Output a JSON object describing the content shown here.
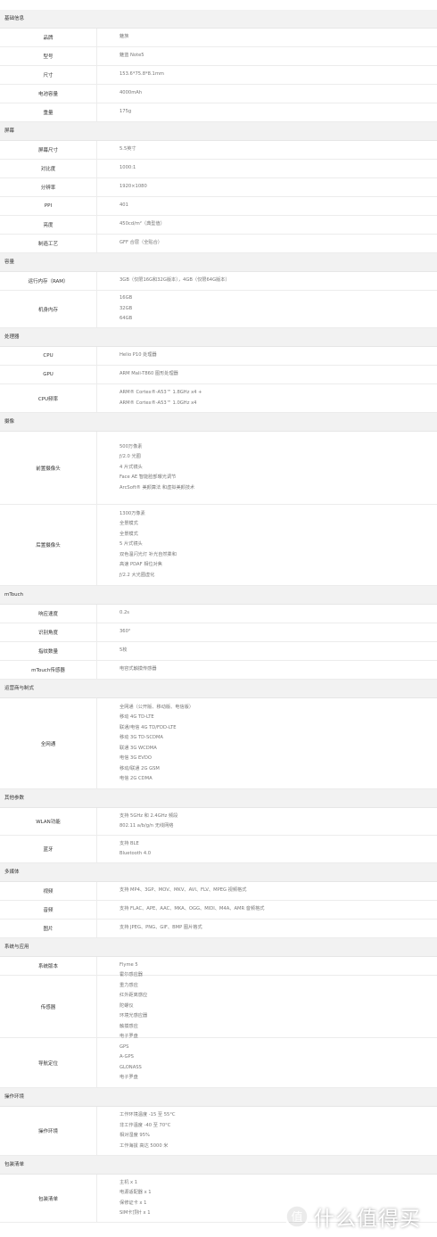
{
  "sections": [
    {
      "title": "基础信息",
      "rows": [
        {
          "label": "品牌",
          "values": [
            "魅族"
          ]
        },
        {
          "label": "型号",
          "values": [
            "魅蓝 Note5"
          ]
        },
        {
          "label": "尺寸",
          "values": [
            "153.6*75.8*8.1mm"
          ]
        },
        {
          "label": "电池容量",
          "values": [
            "4000mAh"
          ]
        },
        {
          "label": "重量",
          "values": [
            "175g"
          ]
        }
      ]
    },
    {
      "title": "屏幕",
      "rows": [
        {
          "label": "屏幕尺寸",
          "values": [
            "5.5英寸"
          ]
        },
        {
          "label": "对比度",
          "values": [
            "1000:1"
          ]
        },
        {
          "label": "分辨率",
          "values": [
            "1920×1080"
          ]
        },
        {
          "label": "PPI",
          "values": [
            "401"
          ]
        },
        {
          "label": "亮度",
          "values": [
            "450cd/m²（典型值）"
          ]
        },
        {
          "label": "制造工艺",
          "values": [
            "GFF 合层（全贴合）"
          ]
        }
      ]
    },
    {
      "title": "容量",
      "rows": [
        {
          "label": "运行内存（RAM）",
          "values": [
            "3GB（仅限16G和32G版本），4GB（仅限64G版本）"
          ]
        },
        {
          "label": "机身内存",
          "values": [
            "16GB",
            "32GB",
            "64GB"
          ]
        }
      ]
    },
    {
      "title": "处理器",
      "rows": [
        {
          "label": "CPU",
          "values": [
            "Helio P10 处理器"
          ]
        },
        {
          "label": "GPU",
          "values": [
            "ARM Mali-T860 图形处理器"
          ]
        },
        {
          "label": "CPU频率",
          "values": [
            "ARM® Cortex®-A53™ 1.8GHz x4 +",
            "ARM® Cortex®-A53™ 1.0GHz x4"
          ]
        }
      ]
    },
    {
      "title": "摄像",
      "rows": [
        {
          "label": "前置摄像头",
          "values": [
            "500万像素",
            "ƒ/2.0 光圈",
            "4 片式镜头",
            "Face AE 智能脸部曝光调节",
            "ArcSoft® 美颜算法 和虚拟美颜技术"
          ]
        },
        {
          "label": "后置摄像头",
          "values": [
            "1300万像素",
            "全景模式",
            "全景模式",
            "5 片式镜头",
            "双色温闪光灯 补光自然柔和",
            "高速 PDAF 相位对焦",
            "ƒ/2.2 大光圈虚化"
          ]
        }
      ]
    },
    {
      "title": "mTouch",
      "rows": [
        {
          "label": "响应速度",
          "values": [
            "0.2s"
          ]
        },
        {
          "label": "识别角度",
          "values": [
            "360°"
          ]
        },
        {
          "label": "指纹数量",
          "values": [
            "5枚"
          ]
        },
        {
          "label": "mTouch传感器",
          "values": [
            "电容式触摸传感器"
          ]
        }
      ]
    },
    {
      "title": "运营商与制式",
      "rows": [
        {
          "label": "全网通",
          "values": [
            "全网通（公开版、移动版、电信版）",
            "移动 4G TD-LTE",
            "联通/电信 4G TD/FDD-LTE",
            "移动 3G TD-SCDMA",
            "联通 3G WCDMA",
            "电信 3G EVDO",
            "移动/联通 2G GSM",
            "电信 2G CDMA"
          ]
        }
      ]
    },
    {
      "title": "其他参数",
      "rows": [
        {
          "label": "WLAN功能",
          "values": [
            "支持 5GHz 和 2.4GHz 频段",
            "802.11 a/b/g/n 无线网络"
          ]
        },
        {
          "label": "蓝牙",
          "values": [
            "支持 BLE",
            "Bluetooth 4.0"
          ]
        }
      ]
    },
    {
      "title": "多媒体",
      "rows": [
        {
          "label": "视频",
          "values": [
            "支持 MP4、3GP、MOV、MKV、AVI、FLV、MPEG 视频格式"
          ]
        },
        {
          "label": "音频",
          "values": [
            "支持 FLAC、APE、AAC、MKA、OGG、MIDI、M4A、AMR 音频格式"
          ]
        },
        {
          "label": "图片",
          "values": [
            "支持 JPEG、PNG、GIF、BMP 图片格式"
          ]
        }
      ]
    },
    {
      "title": "系统与应用",
      "rows": [
        {
          "label": "系统版本",
          "values": [
            "Flyme 5"
          ]
        },
        {
          "label": "传感器",
          "values": [
            "霍尔感应器",
            "重力感应",
            "红外距离感应",
            "陀螺仪",
            "环境光感应器",
            "触摸感应",
            "电子罗盘"
          ]
        },
        {
          "label": "导航定位",
          "values": [
            "GPS",
            "A-GPS",
            "GLONASS",
            "电子罗盘"
          ]
        }
      ]
    },
    {
      "title": "操作环境",
      "rows": [
        {
          "label": "操作环境",
          "values": [
            "工作环境温度 -15 至 55°C",
            "非工作温度 -40 至 70°C",
            "相对湿度 95%",
            "工作海拔 高达 5000 米"
          ]
        }
      ]
    },
    {
      "title": "包装清单",
      "rows": [
        {
          "label": "包装清单",
          "values": [
            "主机 x 1",
            "电源适配器 x 1",
            "保修证卡 x 1",
            "SIM卡顶针 x 1"
          ]
        }
      ]
    }
  ],
  "watermark": {
    "text": "什么值得买",
    "icon": "smzdm-logo-icon",
    "logo_glyph": "值"
  }
}
